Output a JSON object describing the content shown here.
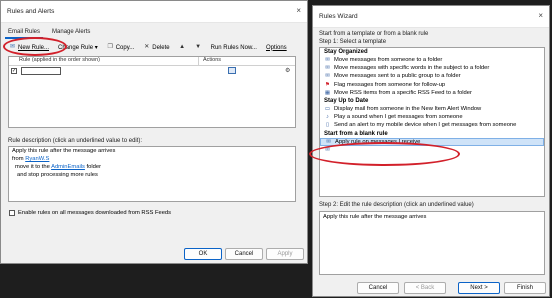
{
  "rules_dialog": {
    "title": "Rules and Alerts",
    "close_glyph": "×",
    "tabs": [
      "Email Rules",
      "Manage Alerts"
    ],
    "toolbar": {
      "new_rule": "New Rule...",
      "change_rule": "Change Rule ▾",
      "copy": "Copy...",
      "delete": "Delete",
      "run_rules": "Run Rules Now...",
      "options": "Options"
    },
    "list": {
      "col_rule": "Rule (applied in the order shown)",
      "col_actions": "Actions"
    },
    "description_label": "Rule description (click an underlined value to edit):",
    "description": {
      "line1": "Apply this rule after the message arrives",
      "line2_prefix": "from ",
      "line2_link": "RyanW.S",
      "line3_prefix": "move it to the ",
      "line3_link": "AdminEmails",
      "line3_suffix": " folder",
      "line4": "and stop processing more rules"
    },
    "rss_checkbox": "Enable rules on all messages downloaded from RSS Feeds",
    "buttons": {
      "ok": "OK",
      "cancel": "Cancel",
      "apply": "Apply"
    }
  },
  "wizard": {
    "title": "Rules Wizard",
    "close_glyph": "×",
    "intro": "Start from a template or from a blank rule",
    "step1": "Step 1: Select a template",
    "sections": [
      {
        "heading": "Stay Organized",
        "items": [
          {
            "icon": "envelope-icon",
            "glyph": "✉",
            "label": "Move messages from someone to a folder"
          },
          {
            "icon": "envelope-icon",
            "glyph": "✉",
            "label": "Move messages with specific words in the subject to a folder"
          },
          {
            "icon": "envelope-icon",
            "glyph": "✉",
            "label": "Move messages sent to a public group to a folder"
          },
          {
            "icon": "flag-icon",
            "glyph": "⚑",
            "label": "Flag messages from someone for follow-up"
          },
          {
            "icon": "rss-icon",
            "glyph": "▦",
            "label": "Move RSS items from a specific RSS Feed to a folder"
          }
        ]
      },
      {
        "heading": "Stay Up to Date",
        "items": [
          {
            "icon": "alert-window-icon",
            "glyph": "▭",
            "label": "Display mail from someone in the New Item Alert Window"
          },
          {
            "icon": "sound-icon",
            "glyph": "♪",
            "label": "Play a sound when I get messages from someone"
          },
          {
            "icon": "mobile-icon",
            "glyph": "▯",
            "label": "Send an alert to my mobile device when I get messages from someone"
          }
        ]
      },
      {
        "heading": "Start from a blank rule",
        "items": [
          {
            "icon": "envelope-icon",
            "glyph": "✉",
            "label": "Apply rule on messages I receive"
          },
          {
            "icon": "envelope-icon",
            "glyph": "✉",
            "label": ""
          }
        ]
      }
    ],
    "step2": "Step 2: Edit the rule description (click an underlined value)",
    "step2_text": "Apply this rule after the message arrives",
    "buttons": {
      "cancel": "Cancel",
      "back": "< Back",
      "next": "Next >",
      "finish": "Finish"
    }
  },
  "colors": {
    "accent": "#0b63c7",
    "annotation_red": "#d2202a",
    "selection": "#cfe3f8"
  }
}
